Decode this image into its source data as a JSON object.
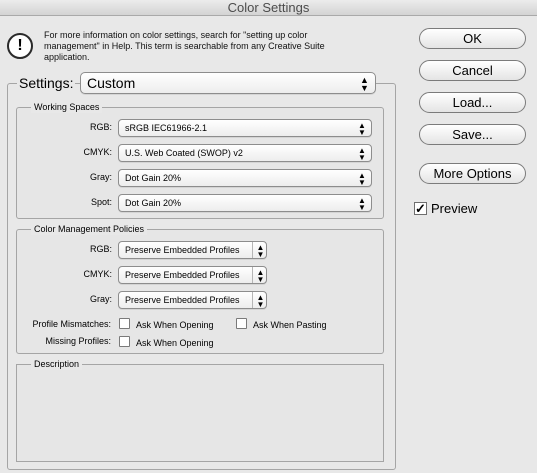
{
  "window": {
    "title": "Color Settings"
  },
  "info": {
    "icon": "alert-icon",
    "text": "For more information on color settings, search for \"setting up color management\" in Help. This term is searchable from any Creative Suite application."
  },
  "settings": {
    "label": "Settings:",
    "value": "Custom"
  },
  "working_spaces": {
    "title": "Working Spaces",
    "rows": [
      {
        "label": "RGB:",
        "value": "sRGB IEC61966-2.1"
      },
      {
        "label": "CMYK:",
        "value": "U.S. Web Coated (SWOP) v2"
      },
      {
        "label": "Gray:",
        "value": "Dot Gain 20%"
      },
      {
        "label": "Spot:",
        "value": "Dot Gain 20%"
      }
    ]
  },
  "policies": {
    "title": "Color Management Policies",
    "rows": [
      {
        "label": "RGB:",
        "value": "Preserve Embedded Profiles"
      },
      {
        "label": "CMYK:",
        "value": "Preserve Embedded Profiles"
      },
      {
        "label": "Gray:",
        "value": "Preserve Embedded Profiles"
      }
    ],
    "mismatch_label": "Profile Mismatches:",
    "ask_opening": "Ask When Opening",
    "ask_pasting": "Ask When Pasting",
    "missing_label": "Missing Profiles:",
    "missing_ask_opening": "Ask When Opening"
  },
  "description": {
    "title": "Description"
  },
  "buttons": {
    "ok": "OK",
    "cancel": "Cancel",
    "load": "Load...",
    "save": "Save...",
    "more_options": "More Options"
  },
  "preview": {
    "label": "Preview",
    "checked": true,
    "check_glyph": "✓"
  }
}
